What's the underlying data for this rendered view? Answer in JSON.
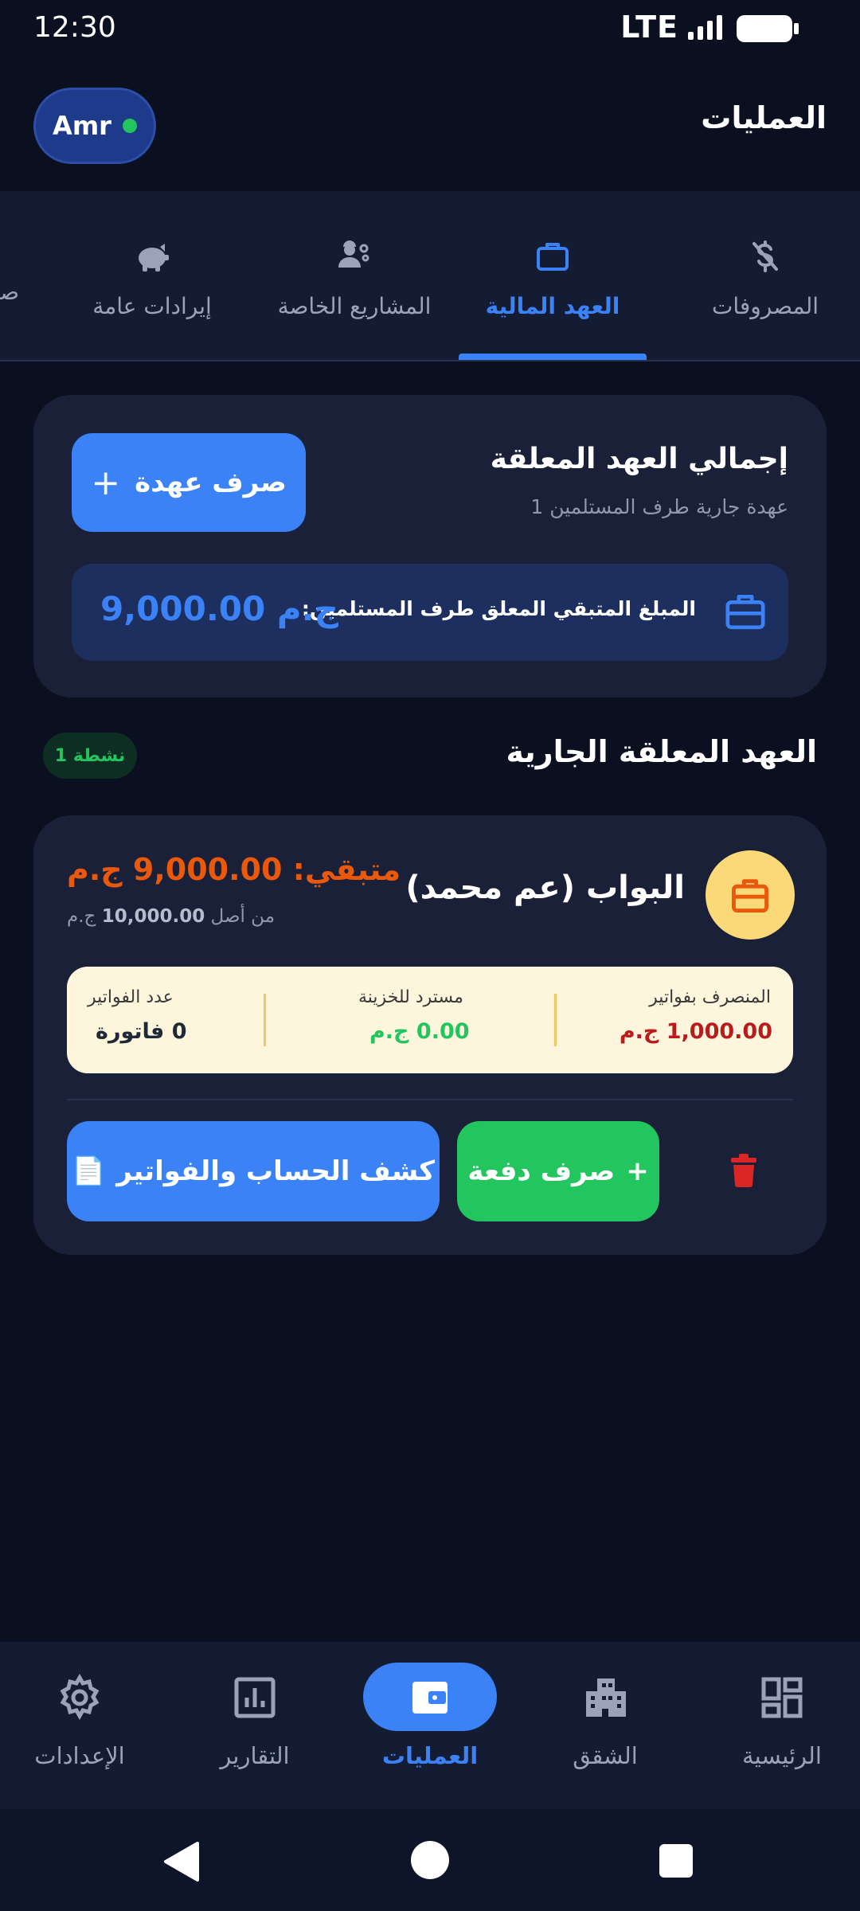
{
  "status_bar": {
    "time": "12:30",
    "network": "LTE"
  },
  "header": {
    "title": "العمليات",
    "user_name": "Amr"
  },
  "tabs": [
    {
      "label": "المصروفات",
      "icon": "dollar-off-icon"
    },
    {
      "label": "العهد المالية",
      "icon": "briefcase-icon",
      "active": true
    },
    {
      "label": "المشاريع الخاصة",
      "icon": "workers-icon"
    },
    {
      "label": "إيرادات عامة",
      "icon": "piggy-bank-icon"
    }
  ],
  "tab_partial": "صـ",
  "summary": {
    "title": "إجمالي العهد المعلقة",
    "subtitle": "1 عهدة جارية طرف المستلمين",
    "issue_button": "صرف عهدة",
    "issue_button_icon": "+",
    "remaining_label": "المبلغ المتبقي المعلق طرف المستلمين:",
    "remaining_amount": "9,000.00 ج.م"
  },
  "section": {
    "title": "العهد المعلقة الجارية",
    "active_badge": "1 نشطة"
  },
  "custody": {
    "holder_name": "البواب (عم محمد)",
    "remaining": "متبقي: 9,000.00 ج.م",
    "of_total_prefix": "من أصل",
    "of_total_amount": "10,000.00",
    "of_total_currency": "ج.م",
    "stats": {
      "spent_label": "المنصرف بفواتير",
      "spent_value": "1,000.00 ج.م",
      "refunded_label": "مسترد للخزينة",
      "refunded_value": "0.00 ج.م",
      "invoices_label": "عدد الفواتير",
      "invoices_value": "0 فاتورة"
    },
    "statement_button": "كشف الحساب والفواتير",
    "statement_button_icon": "📄",
    "pay_button": "صرف دفعة",
    "pay_button_icon": "+"
  },
  "bottom_nav": [
    {
      "label": "الرئيسية",
      "icon": "dashboard-icon"
    },
    {
      "label": "الشقق",
      "icon": "building-icon"
    },
    {
      "label": "العمليات",
      "icon": "wallet-icon",
      "active": true
    },
    {
      "label": "التقارير",
      "icon": "bar-chart-icon"
    },
    {
      "label": "الإعدادات",
      "icon": "gear-icon"
    }
  ],
  "colors": {
    "background": "#0b1020",
    "card": "#192038",
    "accent_blue": "#3b82f6",
    "success_green": "#22c55e",
    "warning_orange": "#ea580c",
    "danger_red": "#dc2626"
  }
}
